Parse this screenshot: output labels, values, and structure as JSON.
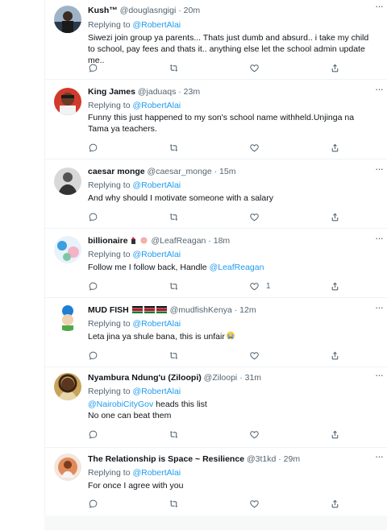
{
  "reply_prefix": "Replying to",
  "icons": {
    "reply": "reply-icon",
    "retweet": "retweet-icon",
    "like": "like-icon",
    "share": "share-icon",
    "more": "more-icon"
  },
  "colors": {
    "link": "#1d9bf0",
    "secondary_text": "#536471",
    "primary_text": "#0f1419",
    "divider": "#eff3f4"
  },
  "tweets": [
    {
      "name": "Kush™",
      "handle": "@douglasngigi",
      "time": "20m",
      "replying_to": "@RobertAlai",
      "text": "Siwezi join group ya parents... Thats just dumb and absurd.. i take my child to school, pay fees and thats it.. anything else let the school admin update me..",
      "likes": ""
    },
    {
      "name": "King James",
      "handle": "@jaduaqs",
      "time": "23m",
      "replying_to": "@RobertAlai",
      "text": "Funny this just happened to my son's school name withheld.Unjinga na Tama ya teachers.",
      "likes": ""
    },
    {
      "name": "caesar monge",
      "handle": "@caesar_monge",
      "time": "15m",
      "replying_to": "@RobertAlai",
      "text": "And why should I motivate someone with a salary",
      "likes": ""
    },
    {
      "name": "billionaire",
      "handle": "@LeafReagan",
      "time": "18m",
      "replying_to": "@RobertAlai",
      "text": "Follow me I follow back, Handle ",
      "text_mention": "@LeafReagan",
      "likes": "1"
    },
    {
      "name": "MUD FISH",
      "handle": "@mudfishKenya",
      "time": "12m",
      "replying_to": "@RobertAlai",
      "text": "Leta jina ya shule bana, this is unfair",
      "likes": ""
    },
    {
      "name": "Nyambura Ndung'u (Ziloopi)",
      "handle": "@Ziloopi",
      "time": "31m",
      "replying_to": "@RobertAlai",
      "text_mention": "@NairobiCityGov",
      "text": " heads this list",
      "text_line2": "No one can beat them",
      "likes": ""
    },
    {
      "name": "The Relationship is Space ~ Resilience",
      "handle": "@3t1kd",
      "time": "29m",
      "replying_to": "@RobertAlai",
      "text": "For once I agree with you",
      "likes": ""
    }
  ]
}
